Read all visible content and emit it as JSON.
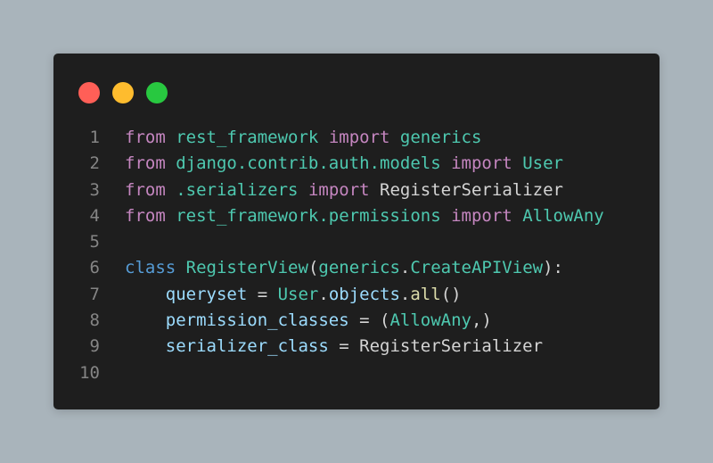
{
  "window": {
    "controls": [
      {
        "name": "close",
        "color": "#ff5f57"
      },
      {
        "name": "minimize",
        "color": "#febc2e"
      },
      {
        "name": "maximize",
        "color": "#28c840"
      }
    ]
  },
  "code": {
    "language": "python",
    "lines": [
      {
        "number": "1",
        "tokens": [
          {
            "t": "from",
            "c": "kw"
          },
          {
            "t": " ",
            "c": "plain"
          },
          {
            "t": "rest_framework",
            "c": "mod"
          },
          {
            "t": " ",
            "c": "plain"
          },
          {
            "t": "import",
            "c": "kw"
          },
          {
            "t": " ",
            "c": "plain"
          },
          {
            "t": "generics",
            "c": "mod"
          }
        ]
      },
      {
        "number": "2",
        "tokens": [
          {
            "t": "from",
            "c": "kw"
          },
          {
            "t": " ",
            "c": "plain"
          },
          {
            "t": "django.contrib.auth.models",
            "c": "mod"
          },
          {
            "t": " ",
            "c": "plain"
          },
          {
            "t": "import",
            "c": "kw"
          },
          {
            "t": " ",
            "c": "plain"
          },
          {
            "t": "User",
            "c": "cls"
          }
        ]
      },
      {
        "number": "3",
        "tokens": [
          {
            "t": "from",
            "c": "kw"
          },
          {
            "t": " ",
            "c": "plain"
          },
          {
            "t": ".serializers",
            "c": "mod"
          },
          {
            "t": " ",
            "c": "plain"
          },
          {
            "t": "import",
            "c": "kw"
          },
          {
            "t": " ",
            "c": "plain"
          },
          {
            "t": "RegisterSerializer",
            "c": "plain"
          }
        ]
      },
      {
        "number": "4",
        "tokens": [
          {
            "t": "from",
            "c": "kw"
          },
          {
            "t": " ",
            "c": "plain"
          },
          {
            "t": "rest_framework.permissions",
            "c": "mod"
          },
          {
            "t": " ",
            "c": "plain"
          },
          {
            "t": "import",
            "c": "kw"
          },
          {
            "t": " ",
            "c": "plain"
          },
          {
            "t": "AllowAny",
            "c": "cls"
          }
        ]
      },
      {
        "number": "5",
        "tokens": []
      },
      {
        "number": "6",
        "tokens": [
          {
            "t": "class",
            "c": "kwb"
          },
          {
            "t": " ",
            "c": "plain"
          },
          {
            "t": "RegisterView",
            "c": "cls"
          },
          {
            "t": "(",
            "c": "plain"
          },
          {
            "t": "generics",
            "c": "mod"
          },
          {
            "t": ".",
            "c": "plain"
          },
          {
            "t": "CreateAPIView",
            "c": "cls"
          },
          {
            "t": "):",
            "c": "plain"
          }
        ]
      },
      {
        "number": "7",
        "tokens": [
          {
            "t": "    ",
            "c": "plain"
          },
          {
            "t": "queryset",
            "c": "var"
          },
          {
            "t": " = ",
            "c": "plain"
          },
          {
            "t": "User",
            "c": "cls"
          },
          {
            "t": ".",
            "c": "plain"
          },
          {
            "t": "objects",
            "c": "var"
          },
          {
            "t": ".",
            "c": "plain"
          },
          {
            "t": "all",
            "c": "fn"
          },
          {
            "t": "()",
            "c": "plain"
          }
        ]
      },
      {
        "number": "8",
        "tokens": [
          {
            "t": "    ",
            "c": "plain"
          },
          {
            "t": "permission_classes",
            "c": "var"
          },
          {
            "t": " = (",
            "c": "plain"
          },
          {
            "t": "AllowAny",
            "c": "cls"
          },
          {
            "t": ",)",
            "c": "plain"
          }
        ]
      },
      {
        "number": "9",
        "tokens": [
          {
            "t": "    ",
            "c": "plain"
          },
          {
            "t": "serializer_class",
            "c": "var"
          },
          {
            "t": " = ",
            "c": "plain"
          },
          {
            "t": "RegisterSerializer",
            "c": "plain"
          }
        ]
      },
      {
        "number": "10",
        "tokens": []
      }
    ]
  }
}
